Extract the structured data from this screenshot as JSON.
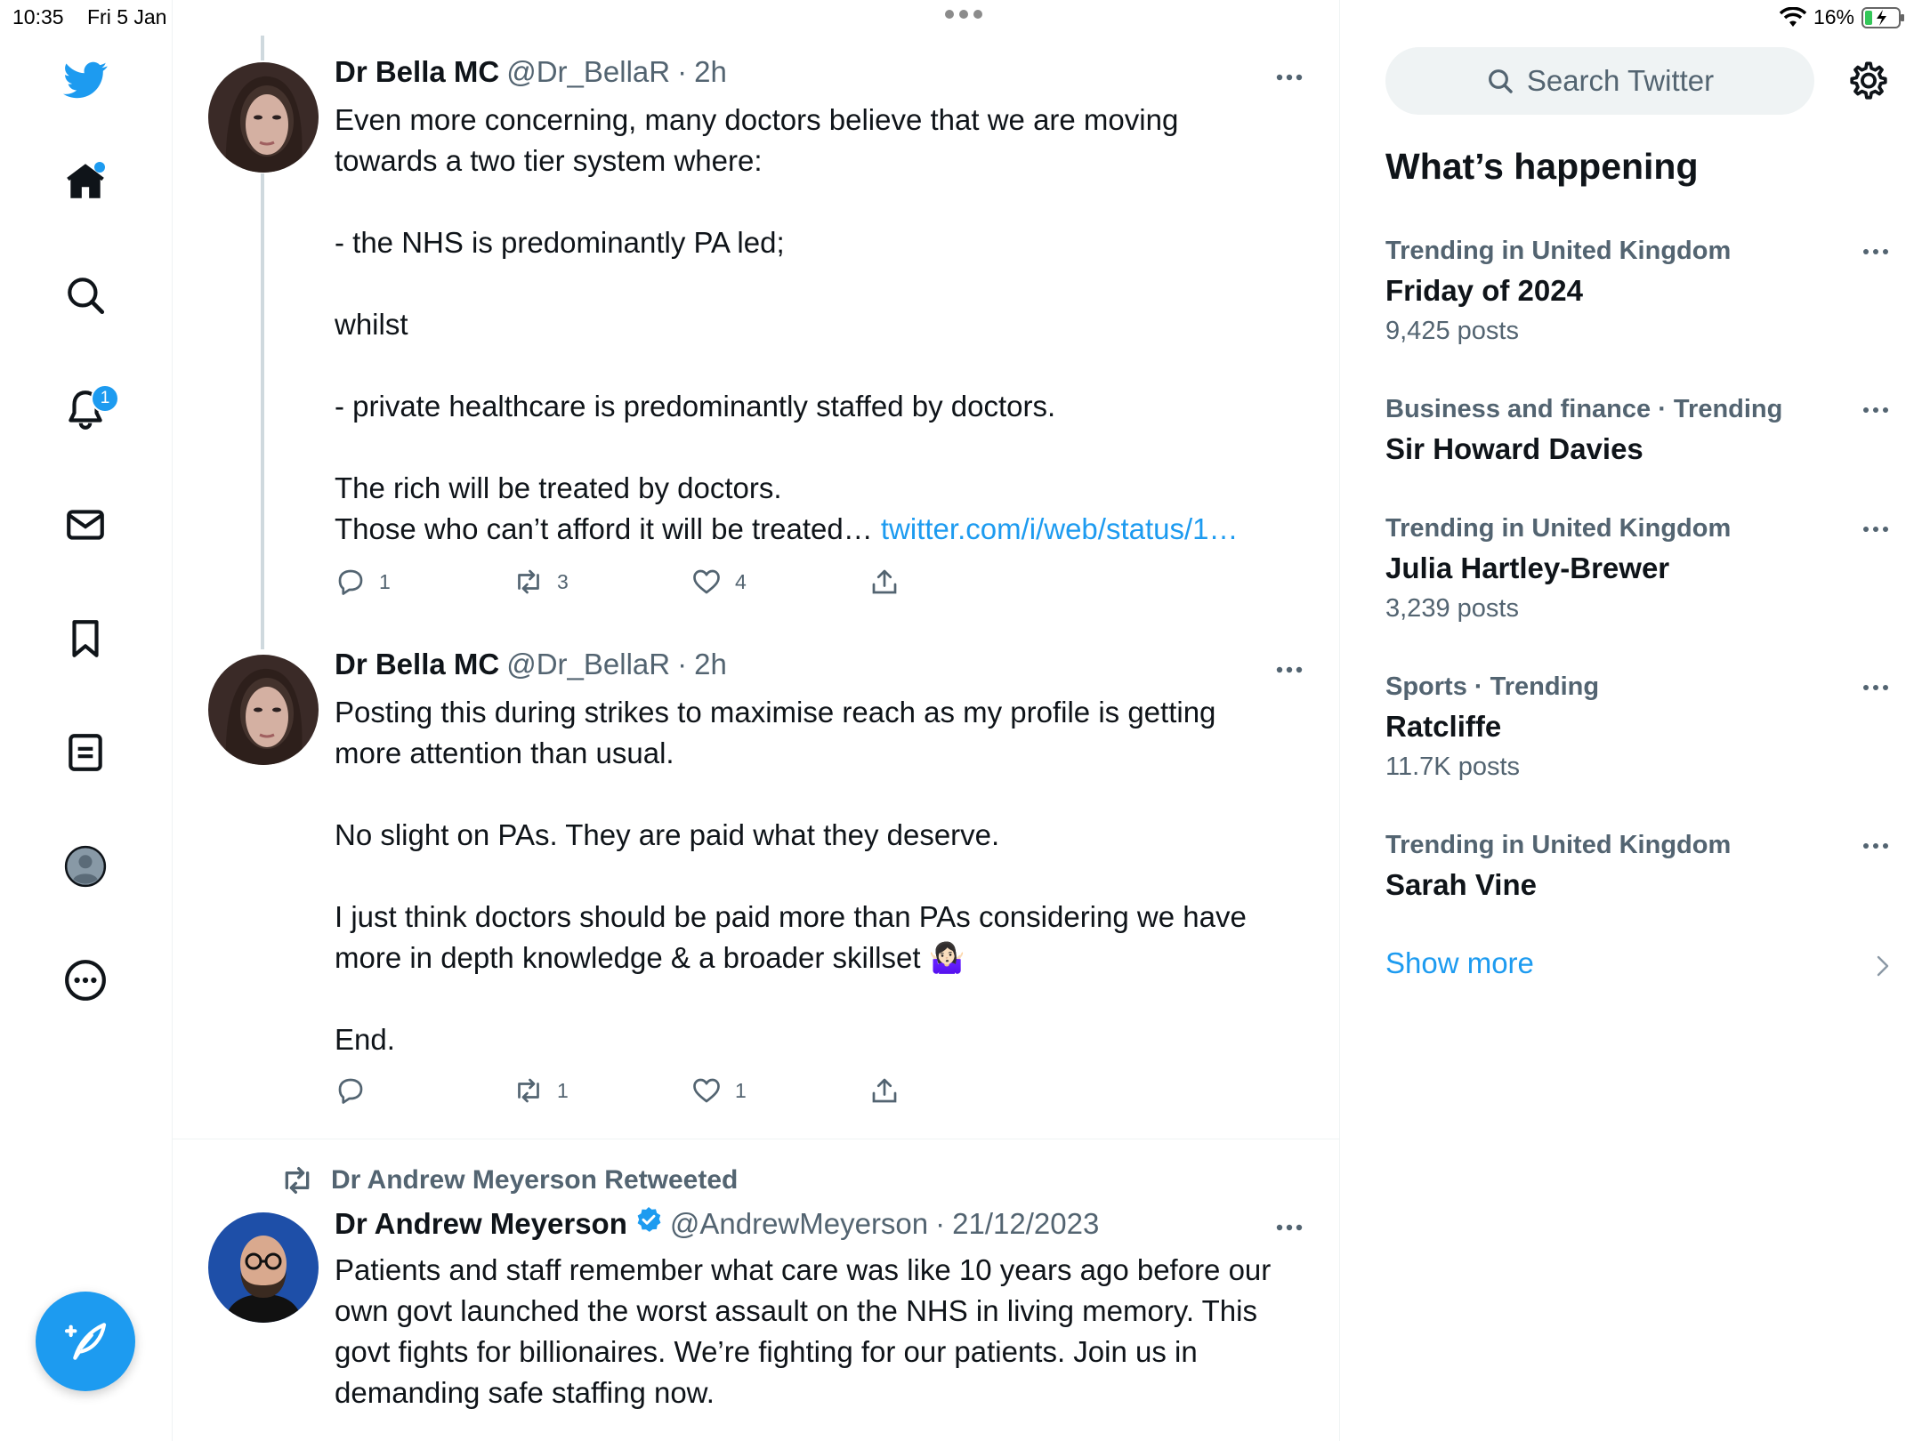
{
  "status_bar": {
    "time": "10:35",
    "date": "Fri 5 Jan",
    "battery": "16%"
  },
  "sidebar": {
    "notifications_badge": "1",
    "items": [
      {
        "name": "home",
        "icon": "home-icon"
      },
      {
        "name": "explore",
        "icon": "search-icon"
      },
      {
        "name": "notifications",
        "icon": "bell-icon"
      },
      {
        "name": "messages",
        "icon": "mail-icon"
      },
      {
        "name": "bookmarks",
        "icon": "bookmark-icon"
      },
      {
        "name": "lists",
        "icon": "list-icon"
      },
      {
        "name": "profile",
        "icon": "profile-icon"
      },
      {
        "name": "more",
        "icon": "more-icon"
      }
    ],
    "compose_icon": "compose-icon"
  },
  "tweets": [
    {
      "name": "Dr Bella MC",
      "handle": "@Dr_BellaR",
      "sep": "·",
      "time": "2h",
      "text": "Even more concerning, many doctors believe that we are moving\ntowards a two tier system where:\n\n- the NHS is predominantly PA led;\n\nwhilst\n\n- private healthcare is predominantly staffed by doctors.\n\nThe rich will be treated by doctors.\nThose who can’t afford it will be treated… ",
      "link": "twitter.com/i/web/status/1…",
      "replies": "1",
      "retweets": "3",
      "likes": "4"
    },
    {
      "name": "Dr Bella MC",
      "handle": "@Dr_BellaR",
      "sep": "·",
      "time": "2h",
      "text": "Posting this during strikes to maximise reach as my profile is getting\nmore attention than usual.\n\nNo slight on PAs. They are paid what they deserve.\n\nI just think doctors should be paid more than PAs considering we have\nmore in depth knowledge & a broader skillset 🤷🏻‍♀️\n\nEnd.",
      "replies": "",
      "retweets": "1",
      "likes": "1"
    },
    {
      "retweeted_by": "Dr Andrew Meyerson Retweeted",
      "name": "Dr Andrew Meyerson",
      "handle": "@AndrewMeyerson",
      "sep": "·",
      "time": "21/12/2023",
      "text": "Patients and staff remember what care was like 10 years ago before our\nown govt launched the worst assault on the NHS in living memory. This\ngovt fights for billionaires. We’re fighting for our patients. Join us in\ndemanding safe staffing now."
    }
  ],
  "right_col": {
    "search_placeholder": "Search Twitter",
    "section_title": "What’s happening",
    "trends": [
      {
        "meta": "Trending in United Kingdom",
        "name": "Friday of 2024",
        "count": "9,425 posts"
      },
      {
        "meta": "Business and finance · Trending",
        "name": "Sir Howard Davies",
        "count": ""
      },
      {
        "meta": "Trending in United Kingdom",
        "name": "Julia Hartley-Brewer",
        "count": "3,239 posts"
      },
      {
        "meta": "Sports · Trending",
        "name": "Ratcliffe",
        "count": "11.7K posts"
      },
      {
        "meta": "Trending in United Kingdom",
        "name": "Sarah Vine",
        "count": ""
      }
    ],
    "show_more": "Show more"
  },
  "colors": {
    "accent": "#1d9bf0",
    "text_primary": "#0f1419",
    "text_secondary": "#536471",
    "divider": "#eff3f4"
  }
}
